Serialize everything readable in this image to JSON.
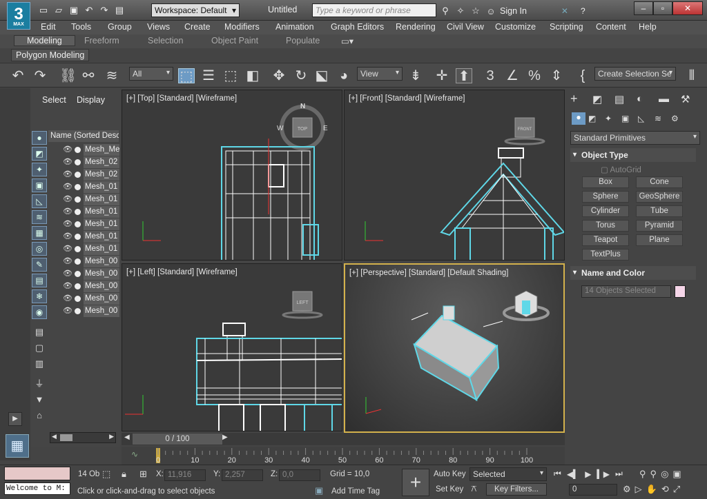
{
  "app": {
    "logo": "3",
    "logo_sub": "MAX",
    "workspace": "Workspace: Default",
    "title": "Untitled",
    "search_placeholder": "Type a keyword or phrase",
    "sign_in": "Sign In"
  },
  "menu": [
    "Edit",
    "Tools",
    "Group",
    "Views",
    "Create",
    "Modifiers",
    "Animation",
    "Graph Editors",
    "Rendering",
    "Civil View",
    "Customize",
    "Scripting",
    "Content",
    "Help"
  ],
  "ribbon": {
    "tabs": [
      "Modeling",
      "Freeform",
      "Selection",
      "Object Paint",
      "Populate"
    ],
    "active": "Modeling",
    "subtab": "Polygon Modeling"
  },
  "toolbar": {
    "filter": "All",
    "view": "View",
    "named_selection": "Create Selection Se"
  },
  "explorer": {
    "tabs": [
      "Select",
      "Display"
    ],
    "column": "Name (Sorted Desce",
    "objects": [
      "Mesh_Me",
      "Mesh_02",
      "Mesh_02",
      "Mesh_01",
      "Mesh_01",
      "Mesh_01",
      "Mesh_01",
      "Mesh_01",
      "Mesh_01",
      "Mesh_00",
      "Mesh_00",
      "Mesh_00",
      "Mesh_00",
      "Mesh_00"
    ]
  },
  "viewports": {
    "top": "[+] [Top] [Standard] [Wireframe]",
    "front": "[+] [Front] [Standard] [Wireframe]",
    "left": "[+] [Left] [Standard] [Wireframe]",
    "perspective": "[+] [Perspective] [Standard] [Default Shading]",
    "cube_top": "TOP",
    "cube_front": "FRONT",
    "cube_left": "LEFT",
    "compass": {
      "n": "N",
      "w": "W",
      "e": "E"
    }
  },
  "cmdpanel": {
    "category": "Standard Primitives",
    "object_type": "Object Type",
    "autogrid": "AutoGrid",
    "buttons": [
      "Box",
      "Cone",
      "Sphere",
      "GeoSphere",
      "Cylinder",
      "Tube",
      "Torus",
      "Pyramid",
      "Teapot",
      "Plane",
      "TextPlus"
    ],
    "name_color": "Name and Color",
    "name_field": "14 Objects Selected",
    "swatch": "#f5d5e8"
  },
  "time": {
    "slider": "0 / 100",
    "ticks": [
      "0",
      "10",
      "20",
      "30",
      "40",
      "50",
      "60",
      "70",
      "80",
      "90",
      "100"
    ]
  },
  "status": {
    "objects": "14 Ob",
    "x_label": "X:",
    "x": "11,916",
    "y_label": "Y:",
    "y": "2,257",
    "z_label": "Z:",
    "z": "0,0",
    "grid": "Grid = 10,0",
    "prompt": "Click or click-and-drag to select objects",
    "add_time_tag": "Add Time Tag",
    "auto_key": "Auto Key",
    "set_key": "Set Key",
    "selected": "Selected",
    "key_filters": "Key Filters...",
    "frame": "0",
    "script": "Welcome to M:"
  },
  "colors": {
    "accent": "#6d9bc5",
    "wire": "#5fd8e8",
    "active_border": "#d4b24c"
  }
}
